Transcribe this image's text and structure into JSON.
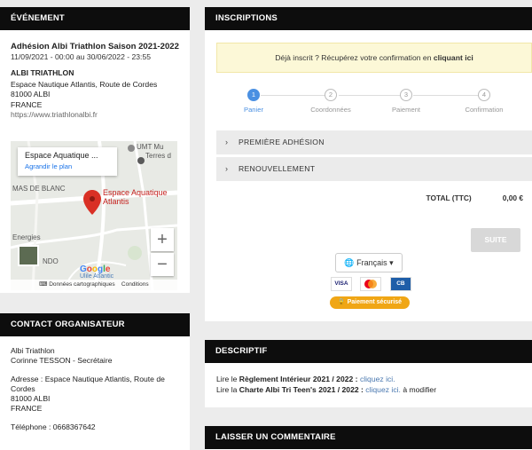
{
  "event": {
    "header": "ÉVÉNEMENT",
    "title": "Adhésion Albi Triathlon Saison 2021-2022",
    "dates": "11/09/2021 - 00:00 au 30/06/2022 - 23:55",
    "org": "ALBI TRIATHLON",
    "address1": "Espace Nautique Atlantis, Route de Cordes",
    "address2": "81000 ALBI",
    "country": "FRANCE",
    "website": "https://www.triathlonalbi.fr",
    "map": {
      "card_title": "Espace Aquatique ...",
      "card_link": "Agrandir le plan",
      "place_label": "Espace Aquatique Atlantis",
      "label_mas": "MAS DE BLANC",
      "label_umt": "UMT Mu",
      "label_terres": "Terres d",
      "label_energies": "Energies",
      "label_ando": "NDO",
      "label_google": "Google",
      "label_ulile": "Ulile Atlantic",
      "zoom_in": "+",
      "zoom_out": "−",
      "footer_data": "Données cartographiques",
      "footer_terms": "Conditions d'utilisation"
    }
  },
  "contact": {
    "header": "CONTACT ORGANISATEUR",
    "line1": "Albi Triathlon",
    "line2": "Corinne TESSON - Secrétaire",
    "address": "Adresse : Espace Nautique Atlantis, Route de Cordes",
    "city": "81000 ALBI",
    "country": "FRANCE",
    "phone": "Téléphone : 0668367642"
  },
  "inscriptions": {
    "header": "INSCRIPTIONS",
    "notice_text": "Déjà inscrit ? Récupérez votre confirmation en",
    "notice_link": "cliquant ici",
    "steps": [
      {
        "num": "1",
        "label": "Panier"
      },
      {
        "num": "2",
        "label": "Coordonnées"
      },
      {
        "num": "3",
        "label": "Paiement"
      },
      {
        "num": "4",
        "label": "Confirmation"
      }
    ],
    "accordion": [
      "PREMIÈRE ADHÉSION",
      "RENOUVELLEMENT"
    ],
    "total_label": "TOTAL (TTC)",
    "total_value": "0,00 €",
    "suite_button": "SUITE",
    "language": "Français",
    "cards": [
      "VISA",
      "MC",
      "CB"
    ],
    "secure_label": "Paiement sécurisé"
  },
  "descriptif": {
    "header": "DESCRIPTIF",
    "l1_prefix": "Lire le ",
    "l1_bold": "Règlement Intérieur 2021 / 2022 :",
    "l1_link": "cliquez ici.",
    "l2_prefix": "Lire la ",
    "l2_bold": "Charte Albi Tri Teen's 2021 / 2022 :",
    "l2_link": "cliquez ici.",
    "l2_suffix": " à modifier"
  },
  "comment": {
    "header": "LAISSER UN COMMENTAIRE"
  },
  "colors": {
    "accent": "#4a90e2",
    "header_bg": "#0d0d0d",
    "secure": "#f0a615",
    "notice_bg": "#fcf8d7"
  }
}
